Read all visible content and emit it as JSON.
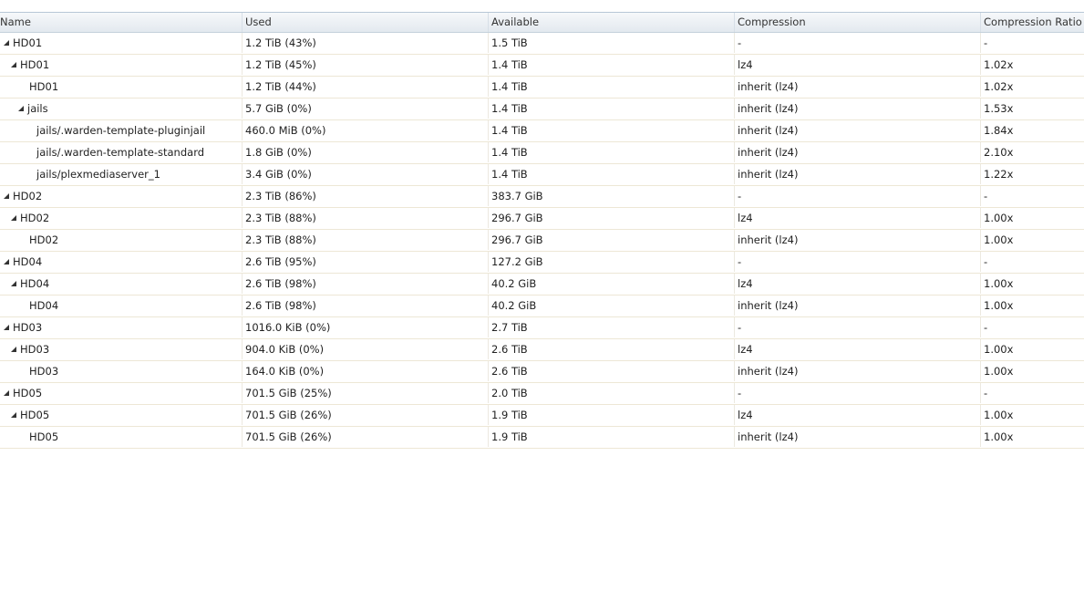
{
  "columns": [
    "Name",
    "Used",
    "Available",
    "Compression",
    "Compression Ratio"
  ],
  "rows": [
    {
      "name": "HD01",
      "level": 0,
      "expandable": true,
      "used": "1.2 TiB (43%)",
      "available": "1.5 TiB",
      "compression": "-",
      "ratio": "-"
    },
    {
      "name": "HD01",
      "level": 1,
      "expandable": true,
      "used": "1.2 TiB (45%)",
      "available": "1.4 TiB",
      "compression": "lz4",
      "ratio": "1.02x"
    },
    {
      "name": "HD01",
      "level": 2,
      "expandable": false,
      "used": "1.2 TiB (44%)",
      "available": "1.4 TiB",
      "compression": "inherit (lz4)",
      "ratio": "1.02x"
    },
    {
      "name": "jails",
      "level": 2,
      "expandable": true,
      "used": "5.7 GiB (0%)",
      "available": "1.4 TiB",
      "compression": "inherit (lz4)",
      "ratio": "1.53x"
    },
    {
      "name": "jails/.warden-template-pluginjail",
      "level": 3,
      "expandable": false,
      "used": "460.0 MiB (0%)",
      "available": "1.4 TiB",
      "compression": "inherit (lz4)",
      "ratio": "1.84x"
    },
    {
      "name": "jails/.warden-template-standard",
      "level": 3,
      "expandable": false,
      "used": "1.8 GiB (0%)",
      "available": "1.4 TiB",
      "compression": "inherit (lz4)",
      "ratio": "2.10x"
    },
    {
      "name": "jails/plexmediaserver_1",
      "level": 3,
      "expandable": false,
      "used": "3.4 GiB (0%)",
      "available": "1.4 TiB",
      "compression": "inherit (lz4)",
      "ratio": "1.22x"
    },
    {
      "name": "HD02",
      "level": 0,
      "expandable": true,
      "used": "2.3 TiB (86%)",
      "available": "383.7 GiB",
      "compression": "-",
      "ratio": "-"
    },
    {
      "name": "HD02",
      "level": 1,
      "expandable": true,
      "used": "2.3 TiB (88%)",
      "available": "296.7 GiB",
      "compression": "lz4",
      "ratio": "1.00x"
    },
    {
      "name": "HD02",
      "level": 2,
      "expandable": false,
      "used": "2.3 TiB (88%)",
      "available": "296.7 GiB",
      "compression": "inherit (lz4)",
      "ratio": "1.00x"
    },
    {
      "name": "HD04",
      "level": 0,
      "expandable": true,
      "used": "2.6 TiB (95%)",
      "available": "127.2 GiB",
      "compression": "-",
      "ratio": "-"
    },
    {
      "name": "HD04",
      "level": 1,
      "expandable": true,
      "used": "2.6 TiB (98%)",
      "available": "40.2 GiB",
      "compression": "lz4",
      "ratio": "1.00x"
    },
    {
      "name": "HD04",
      "level": 2,
      "expandable": false,
      "used": "2.6 TiB (98%)",
      "available": "40.2 GiB",
      "compression": "inherit (lz4)",
      "ratio": "1.00x"
    },
    {
      "name": "HD03",
      "level": 0,
      "expandable": true,
      "used": "1016.0 KiB (0%)",
      "available": "2.7 TiB",
      "compression": "-",
      "ratio": "-"
    },
    {
      "name": "HD03",
      "level": 1,
      "expandable": true,
      "used": "904.0 KiB (0%)",
      "available": "2.6 TiB",
      "compression": "lz4",
      "ratio": "1.00x"
    },
    {
      "name": "HD03",
      "level": 2,
      "expandable": false,
      "used": "164.0 KiB (0%)",
      "available": "2.6 TiB",
      "compression": "inherit (lz4)",
      "ratio": "1.00x"
    },
    {
      "name": "HD05",
      "level": 0,
      "expandable": true,
      "used": "701.5 GiB (25%)",
      "available": "2.0 TiB",
      "compression": "-",
      "ratio": "-"
    },
    {
      "name": "HD05",
      "level": 1,
      "expandable": true,
      "used": "701.5 GiB (26%)",
      "available": "1.9 TiB",
      "compression": "lz4",
      "ratio": "1.00x"
    },
    {
      "name": "HD05",
      "level": 2,
      "expandable": false,
      "used": "701.5 GiB (26%)",
      "available": "1.9 TiB",
      "compression": "inherit (lz4)",
      "ratio": "1.00x"
    }
  ]
}
